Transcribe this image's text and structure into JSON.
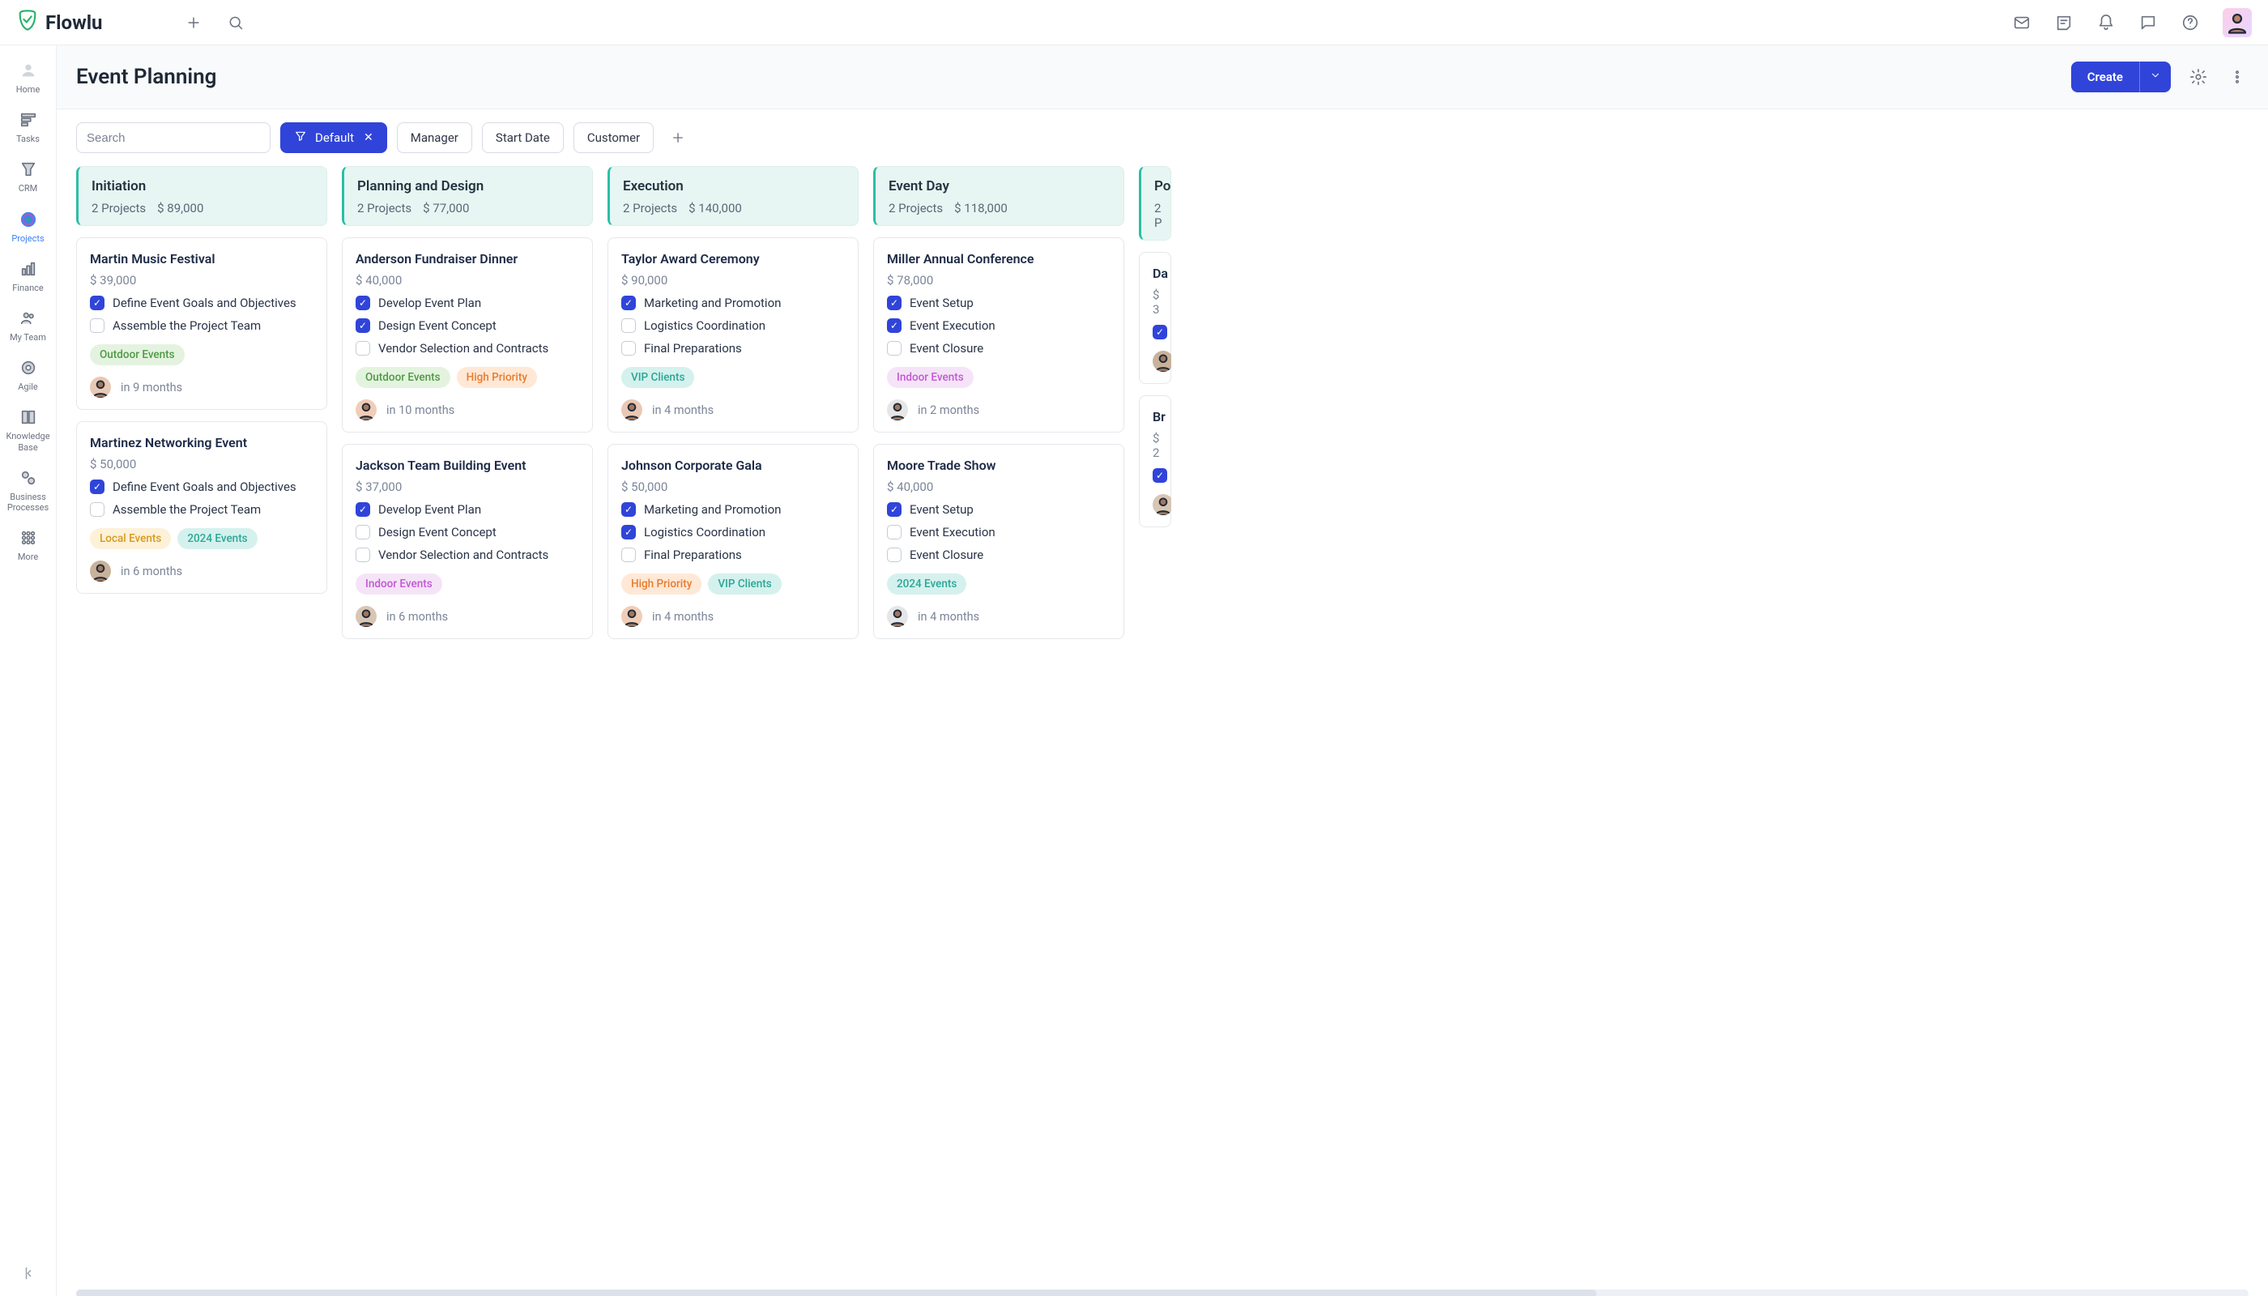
{
  "app": {
    "name": "Flowlu"
  },
  "sidebar": {
    "items": [
      {
        "label": "Home"
      },
      {
        "label": "Tasks"
      },
      {
        "label": "CRM"
      },
      {
        "label": "Projects"
      },
      {
        "label": "Finance"
      },
      {
        "label": "My Team"
      },
      {
        "label": "Agile"
      },
      {
        "label": "Knowledge Base"
      },
      {
        "label": "Business Processes"
      },
      {
        "label": "More"
      }
    ],
    "active_index": 3
  },
  "header": {
    "title": "Event Planning",
    "create_label": "Create"
  },
  "filters": {
    "search_placeholder": "Search",
    "active": {
      "label": "Default"
    },
    "options": [
      "Manager",
      "Start Date",
      "Customer"
    ]
  },
  "tag_styles": {
    "Outdoor Events": {
      "bg": "#e4f3df",
      "fg": "#4f9a46"
    },
    "Indoor Events": {
      "bg": "#f5e4f7",
      "fg": "#c258d6"
    },
    "High Priority": {
      "bg": "#ffe8d6",
      "fg": "#e87c2f"
    },
    "VIP Clients": {
      "bg": "#d5f1ee",
      "fg": "#2aa795"
    },
    "Local Events": {
      "bg": "#fdf1d8",
      "fg": "#d79a1f"
    },
    "2024 Events": {
      "bg": "#d5f1ee",
      "fg": "#2aa795"
    }
  },
  "avatar_colors": [
    "#e9c8b5",
    "#c9b29b",
    "#f0cdb8",
    "#d8c6b4",
    "#e6e6e6"
  ],
  "columns": [
    {
      "name": "Initiation",
      "count_label": "2 Projects",
      "total": "$ 89,000",
      "cards": [
        {
          "title": "Martin Music Festival",
          "amount": "$ 39,000",
          "tasks": [
            {
              "label": "Define Event Goals and Objectives",
              "done": true
            },
            {
              "label": "Assemble the Project Team",
              "done": false
            }
          ],
          "tags": [
            "Outdoor Events"
          ],
          "avatar": 0,
          "due": "in 9 months"
        },
        {
          "title": "Martinez Networking Event",
          "amount": "$ 50,000",
          "tasks": [
            {
              "label": "Define Event Goals and Objectives",
              "done": true
            },
            {
              "label": "Assemble the Project Team",
              "done": false
            }
          ],
          "tags": [
            "Local Events",
            "2024 Events"
          ],
          "avatar": 1,
          "due": "in 6 months"
        }
      ]
    },
    {
      "name": "Planning and Design",
      "count_label": "2 Projects",
      "total": "$ 77,000",
      "cards": [
        {
          "title": "Anderson Fundraiser Dinner",
          "amount": "$ 40,000",
          "tasks": [
            {
              "label": "Develop Event Plan",
              "done": true
            },
            {
              "label": "Design Event Concept",
              "done": true
            },
            {
              "label": "Vendor Selection and Contracts",
              "done": false
            }
          ],
          "tags": [
            "Outdoor Events",
            "High Priority"
          ],
          "avatar": 2,
          "due": "in 10 months"
        },
        {
          "title": "Jackson Team Building Event",
          "amount": "$ 37,000",
          "tasks": [
            {
              "label": "Develop Event Plan",
              "done": true
            },
            {
              "label": "Design Event Concept",
              "done": false
            },
            {
              "label": "Vendor Selection and Contracts",
              "done": false
            }
          ],
          "tags": [
            "Indoor Events"
          ],
          "avatar": 3,
          "due": "in 6 months"
        }
      ]
    },
    {
      "name": "Execution",
      "count_label": "2 Projects",
      "total": "$ 140,000",
      "cards": [
        {
          "title": "Taylor Award Ceremony",
          "amount": "$ 90,000",
          "tasks": [
            {
              "label": "Marketing and Promotion",
              "done": true
            },
            {
              "label": "Logistics Coordination",
              "done": false
            },
            {
              "label": "Final Preparations",
              "done": false
            }
          ],
          "tags": [
            "VIP Clients"
          ],
          "avatar": 0,
          "due": "in 4 months"
        },
        {
          "title": "Johnson Corporate Gala",
          "amount": "$ 50,000",
          "tasks": [
            {
              "label": "Marketing and Promotion",
              "done": true
            },
            {
              "label": "Logistics Coordination",
              "done": true
            },
            {
              "label": "Final Preparations",
              "done": false
            }
          ],
          "tags": [
            "High Priority",
            "VIP Clients"
          ],
          "avatar": 2,
          "due": "in 4 months"
        }
      ]
    },
    {
      "name": "Event Day",
      "count_label": "2 Projects",
      "total": "$ 118,000",
      "cards": [
        {
          "title": "Miller Annual Conference",
          "amount": "$ 78,000",
          "tasks": [
            {
              "label": "Event Setup",
              "done": true
            },
            {
              "label": "Event Execution",
              "done": true
            },
            {
              "label": "Event Closure",
              "done": false
            }
          ],
          "tags": [
            "Indoor Events"
          ],
          "avatar": 4,
          "due": "in 2 months"
        },
        {
          "title": "Moore Trade Show",
          "amount": "$ 40,000",
          "tasks": [
            {
              "label": "Event Setup",
              "done": true
            },
            {
              "label": "Event Execution",
              "done": false
            },
            {
              "label": "Event Closure",
              "done": false
            }
          ],
          "tags": [
            "2024 Events"
          ],
          "avatar": 4,
          "due": "in 4 months"
        }
      ]
    },
    {
      "name": "Po",
      "count_label": "2 P",
      "total": "",
      "cards": [
        {
          "title": "Da",
          "amount": "$ 3",
          "tasks": [
            {
              "label": "",
              "done": true
            }
          ],
          "tags": [],
          "avatar": 1,
          "due": ""
        },
        {
          "title": "Br",
          "amount": "$ 2",
          "tasks": [
            {
              "label": "",
              "done": true
            }
          ],
          "tags": [],
          "avatar": 3,
          "due": ""
        }
      ]
    }
  ]
}
